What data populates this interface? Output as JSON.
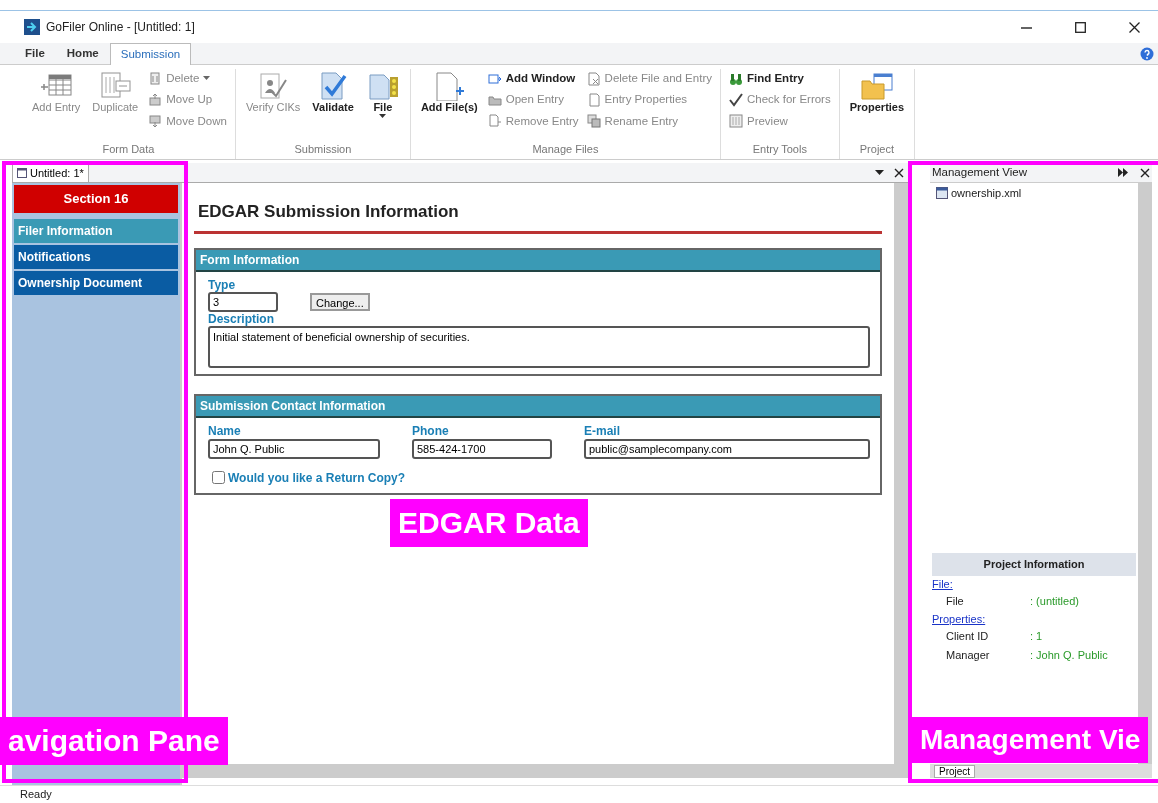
{
  "window": {
    "title": "GoFiler Online - [Untitled: 1]"
  },
  "ribbon_tabs": [
    {
      "label": "File",
      "selected": false
    },
    {
      "label": "Home",
      "selected": false
    },
    {
      "label": "Submission",
      "selected": true
    }
  ],
  "ribbon_groups": [
    {
      "label": "Form Data",
      "large": [
        {
          "label": "Add Entry",
          "disabled": true
        },
        {
          "label": "Duplicate",
          "disabled": true
        }
      ],
      "small": [
        {
          "label": "Delete",
          "disabled": true,
          "dropdown": true
        },
        {
          "label": "Move Up",
          "disabled": true
        },
        {
          "label": "Move Down",
          "disabled": true
        }
      ]
    },
    {
      "label": "Submission",
      "large": [
        {
          "label": "Verify CIKs",
          "disabled": true
        },
        {
          "label": "Validate",
          "disabled": false
        },
        {
          "label": "File",
          "disabled": false,
          "dropdown": true
        }
      ]
    },
    {
      "label": "Manage Files",
      "large": [
        {
          "label": "Add File(s)",
          "disabled": false
        }
      ],
      "small": [
        {
          "label": "Add Window",
          "disabled": false
        },
        {
          "label": "Open Entry",
          "disabled": true
        },
        {
          "label": "Remove Entry",
          "disabled": true
        },
        {
          "label": "Delete File and Entry",
          "disabled": true
        },
        {
          "label": "Entry Properties",
          "disabled": true
        },
        {
          "label": "Rename Entry",
          "disabled": true
        }
      ]
    },
    {
      "label": "Entry Tools",
      "small": [
        {
          "label": "Find Entry",
          "disabled": false
        },
        {
          "label": "Check for Errors",
          "disabled": true
        },
        {
          "label": "Preview",
          "disabled": true
        }
      ]
    },
    {
      "label": "Project",
      "large": [
        {
          "label": "Properties",
          "disabled": false
        }
      ]
    }
  ],
  "document_tab": {
    "label": "Untitled: 1*"
  },
  "navigation": {
    "header": "Section 16",
    "items": [
      {
        "label": "Filer Information",
        "selected": true
      },
      {
        "label": "Notifications",
        "selected": false
      },
      {
        "label": "Ownership Document",
        "selected": false
      }
    ]
  },
  "form": {
    "title": "EDGAR Submission Information",
    "sections": [
      {
        "title": "Form Information",
        "type_label": "Type",
        "type_value": "3",
        "change_button": "Change...",
        "description_label": "Description",
        "description_value": "Initial statement of beneficial ownership of securities."
      },
      {
        "title": "Submission Contact Information",
        "fields": [
          {
            "label": "Name",
            "value": "John Q. Public"
          },
          {
            "label": "Phone",
            "value": "585-424-1700"
          },
          {
            "label": "E-mail",
            "value": "public@samplecompany.com"
          }
        ],
        "return_copy": {
          "label": "Would you like a Return Copy?",
          "checked": false
        }
      }
    ]
  },
  "management_view": {
    "title": "Management View",
    "files": [
      "ownership.xml"
    ],
    "project_information": {
      "title": "Project Information",
      "groups": [
        {
          "heading": "File:",
          "rows": [
            {
              "key": "File",
              "value": ": (untitled)"
            }
          ]
        },
        {
          "heading": "Properties:",
          "rows": [
            {
              "key": "Client ID",
              "value": ": 1"
            },
            {
              "key": "Manager",
              "value": ": John Q. Public"
            }
          ]
        }
      ]
    },
    "bottom_tab": "Project"
  },
  "status_bar": {
    "text": "Ready"
  },
  "annotations": [
    {
      "label": "avigation Pane"
    },
    {
      "label": "EDGAR Data"
    },
    {
      "label": "Management Vie"
    }
  ]
}
